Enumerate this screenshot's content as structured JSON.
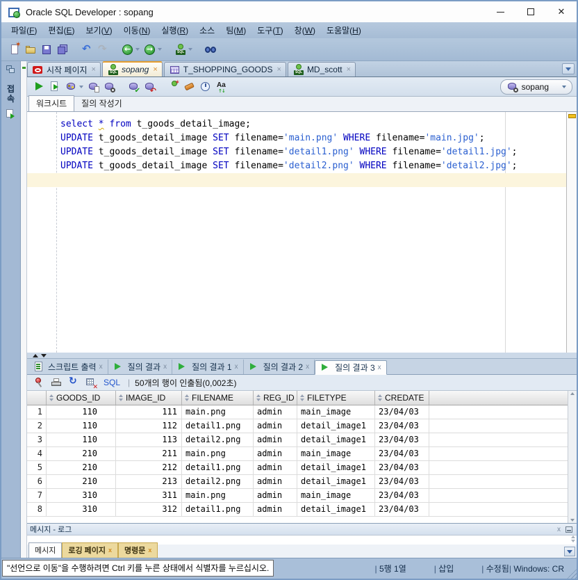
{
  "window": {
    "title": "Oracle SQL Developer : sopang"
  },
  "menubar": {
    "items": [
      "파일(F)",
      "편집(E)",
      "보기(V)",
      "이동(N)",
      "실행(R)",
      "소스",
      "팀(M)",
      "도구(T)",
      "창(W)",
      "도움말(H)"
    ]
  },
  "main_toolbar": {
    "buttons": [
      {
        "icon": "new-file"
      },
      {
        "icon": "open-folder"
      },
      {
        "icon": "save"
      },
      {
        "icon": "save-all"
      },
      {
        "sep": true
      },
      {
        "icon": "undo"
      },
      {
        "icon": "redo"
      },
      {
        "sep": true
      },
      {
        "icon": "nav-back",
        "caret": true
      },
      {
        "icon": "nav-forward",
        "caret": true
      },
      {
        "sep": true
      },
      {
        "icon": "sql-connect",
        "caret": true
      },
      {
        "sep": true
      },
      {
        "icon": "search"
      }
    ]
  },
  "side_rail": {
    "vertical_label": "접속"
  },
  "editor_tabs": [
    {
      "label": "시작 페이지",
      "icon": "oracle",
      "close": "×"
    },
    {
      "label": "sopang",
      "icon": "sql-user",
      "close": "×",
      "active": true
    },
    {
      "label": "T_SHOPPING_GOODS",
      "icon": "table",
      "close": "×"
    },
    {
      "label": "MD_scott",
      "icon": "sql-user",
      "close": "×"
    }
  ],
  "worksheet_toolbar": {
    "buttons": [
      {
        "icon": "run"
      },
      {
        "icon": "run-script"
      },
      {
        "icon": "explain-plan",
        "caret": true
      },
      {
        "icon": "autotrace"
      },
      {
        "icon": "tuning"
      },
      {
        "sep": true
      },
      {
        "icon": "commit"
      },
      {
        "icon": "rollback"
      },
      {
        "sep": true
      },
      {
        "icon": "unshared-worksheet"
      },
      {
        "icon": "clear"
      },
      {
        "icon": "history"
      },
      {
        "icon": "to-case"
      },
      {
        "sep": true
      }
    ],
    "connection": {
      "label": "sopang",
      "icon": "db-connection"
    }
  },
  "subtabs": [
    {
      "label": "워크시트",
      "active": true
    },
    {
      "label": "질의 작성기"
    }
  ],
  "editor": {
    "syntax_colors": {
      "keyword": "#0000c0",
      "string": "#2a5fd0",
      "plain": "#000000"
    },
    "lines": [
      {
        "tokens": [
          [
            "kw",
            "select"
          ],
          [
            "pl",
            " "
          ],
          [
            "warn",
            "*"
          ],
          [
            "pl",
            " "
          ],
          [
            "kw",
            "from"
          ],
          [
            "pl",
            " t_goods_detail_image;"
          ]
        ]
      },
      {
        "tokens": [
          [
            "kw",
            "UPDATE"
          ],
          [
            "pl",
            " t_goods_detail_image "
          ],
          [
            "kw",
            "SET"
          ],
          [
            "pl",
            " filename="
          ],
          [
            "str",
            "'main.png'"
          ],
          [
            "pl",
            " "
          ],
          [
            "kw",
            "WHERE"
          ],
          [
            "pl",
            " filename="
          ],
          [
            "str",
            "'main.jpg'"
          ],
          [
            "pl",
            ";"
          ]
        ]
      },
      {
        "tokens": [
          [
            "kw",
            "UPDATE"
          ],
          [
            "pl",
            " t_goods_detail_image "
          ],
          [
            "kw",
            "SET"
          ],
          [
            "pl",
            " filename="
          ],
          [
            "str",
            "'detail1.png'"
          ],
          [
            "pl",
            " "
          ],
          [
            "kw",
            "WHERE"
          ],
          [
            "pl",
            " filename="
          ],
          [
            "str",
            "'detail1.jpg'"
          ],
          [
            "pl",
            ";"
          ]
        ]
      },
      {
        "tokens": [
          [
            "kw",
            "UPDATE"
          ],
          [
            "pl",
            " t_goods_detail_image "
          ],
          [
            "kw",
            "SET"
          ],
          [
            "pl",
            " filename="
          ],
          [
            "str",
            "'detail2.png'"
          ],
          [
            "pl",
            " "
          ],
          [
            "kw",
            "WHERE"
          ],
          [
            "pl",
            " filename="
          ],
          [
            "str",
            "'detail2.jpg'"
          ],
          [
            "pl",
            ";"
          ]
        ]
      },
      {
        "tokens": [],
        "current": true
      }
    ]
  },
  "results_tabs": [
    {
      "label": "스크립트 출력",
      "icon": "script-output",
      "close": "x"
    },
    {
      "label": "질의 결과",
      "icon": "run-small",
      "close": "x"
    },
    {
      "label": "질의 결과 1",
      "icon": "run-small",
      "close": "x"
    },
    {
      "label": "질의 결과 2",
      "icon": "run-small",
      "close": "x"
    },
    {
      "label": "질의 결과 3",
      "icon": "run-small",
      "close": "x",
      "active": true
    }
  ],
  "results_toolbar": {
    "buttons": [
      {
        "icon": "pin"
      },
      {
        "icon": "print"
      },
      {
        "icon": "refresh"
      },
      {
        "icon": "delete-grid"
      }
    ],
    "sql_link": "SQL",
    "status": "50개의 행이 인출됨(0,002초)"
  },
  "grid": {
    "columns": [
      {
        "label": "GOODS_ID"
      },
      {
        "label": "IMAGE_ID"
      },
      {
        "label": "FILENAME"
      },
      {
        "label": "REG_ID"
      },
      {
        "label": "FILETYPE"
      },
      {
        "label": "CREDATE"
      }
    ],
    "rows": [
      [
        "110",
        "111",
        "main.png",
        "admin",
        "main_image",
        "23/04/03"
      ],
      [
        "110",
        "112",
        "detail1.png",
        "admin",
        "detail_image1",
        "23/04/03"
      ],
      [
        "110",
        "113",
        "detail2.png",
        "admin",
        "detail_image1",
        "23/04/03"
      ],
      [
        "210",
        "211",
        "main.png",
        "admin",
        "main_image",
        "23/04/03"
      ],
      [
        "210",
        "212",
        "detail1.png",
        "admin",
        "detail_image1",
        "23/04/03"
      ],
      [
        "210",
        "213",
        "detail2.png",
        "admin",
        "detail_image1",
        "23/04/03"
      ],
      [
        "310",
        "311",
        "main.png",
        "admin",
        "main_image",
        "23/04/03"
      ],
      [
        "310",
        "312",
        "detail1.png",
        "admin",
        "detail_image1",
        "23/04/03"
      ]
    ]
  },
  "message_panel": {
    "title": "메시지 - 로그",
    "tabs": [
      {
        "label": "메시지",
        "active": true
      },
      {
        "label": "로깅 페이지",
        "close": "x",
        "highlight": true
      },
      {
        "label": "명령문",
        "close": "x",
        "highlight": true
      }
    ]
  },
  "statusbar": {
    "hint": "\"선언으로 이동\"을 수행하려면 Ctrl 키를 누른 상태에서 식별자를 누르십시오.",
    "caret_position": "5행 1열",
    "insert_mode": "삽입",
    "modified": "수정됨",
    "line_ending": "Windows: CR"
  }
}
